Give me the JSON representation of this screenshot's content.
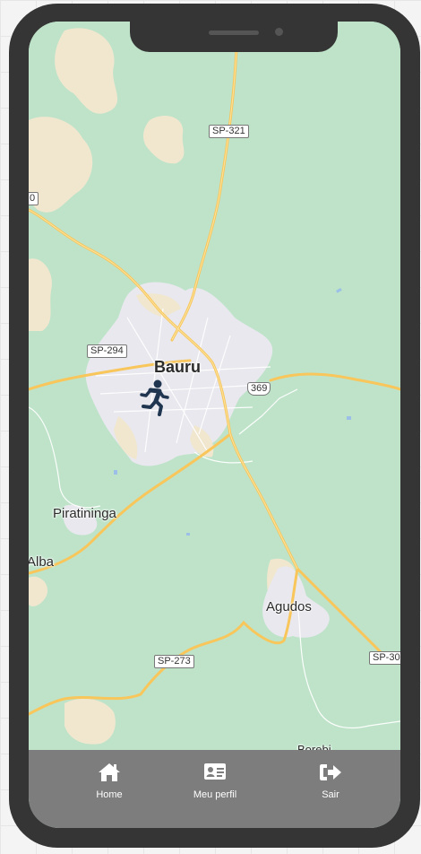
{
  "map": {
    "city_main": "Bauru",
    "cities": {
      "piratininga": "Piratininga",
      "agudos": "Agudos",
      "alba": "Alba",
      "borebi": "Borebi"
    },
    "roads": {
      "sp321": "SP-321",
      "sp294": "SP-294",
      "r369": "369",
      "sp273": "SP-273",
      "sp30": "SP-30",
      "left_cut": "0"
    },
    "marker_icon": "running-person-icon"
  },
  "nav": {
    "home_label": "Home",
    "home_icon": "home-icon",
    "profile_label": "Meu perfil",
    "profile_icon": "id-card-icon",
    "logout_label": "Sair",
    "logout_icon": "sign-out-icon"
  },
  "colors": {
    "map_green": "#bee3c9",
    "urban": "#e8e8ee",
    "sand": "#f1e7cf",
    "road": "#f8c65a",
    "navbar": "#7d7d7d",
    "phone_frame": "#353535",
    "marker": "#1f3550"
  }
}
